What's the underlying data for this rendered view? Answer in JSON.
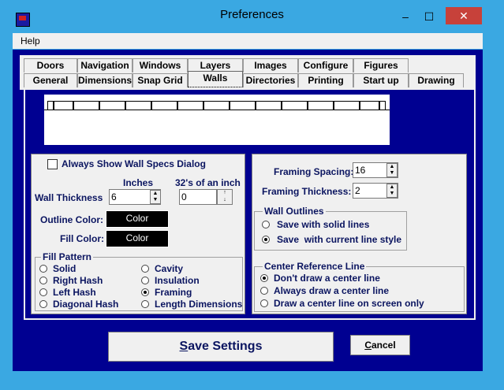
{
  "window": {
    "title": "Preferences",
    "minimize": "–",
    "maximize": "☐",
    "close": "✕"
  },
  "menu": {
    "help": "Help"
  },
  "tabs": {
    "row1": [
      "Doors",
      "Navigation",
      "Windows",
      "Layers",
      "Images",
      "Configure",
      "Figures"
    ],
    "row2": [
      "General",
      "Dimensions",
      "Snap Grid",
      "Walls",
      "Directories",
      "Printing",
      "Start up",
      "Drawing"
    ],
    "active": "Walls"
  },
  "left": {
    "always_show": "Always Show Wall Specs Dialog",
    "inches_label": "Inches",
    "fraction_label": "32's of an inch",
    "wall_thickness_label": "Wall Thickness",
    "inches_value": "6",
    "fraction_value": "0",
    "outline_color_label": "Outline Color:",
    "fill_color_label": "Fill Color:",
    "color_button": "Color",
    "fill_pattern": {
      "title": "Fill Pattern",
      "options": [
        "Solid",
        "Right Hash",
        "Left Hash",
        "Diagonal Hash",
        "Cavity",
        "Insulation",
        "Framing",
        "Length Dimensions"
      ],
      "selected": "Framing"
    }
  },
  "right": {
    "framing_spacing_label": "Framing Spacing:",
    "framing_spacing_value": "16",
    "framing_thickness_label": "Framing Thickness:",
    "framing_thickness_value": "2",
    "wall_outlines": {
      "title": "Wall Outlines",
      "options": [
        "Save with solid lines",
        "Save  with current line style"
      ],
      "selected": "Save  with current line style"
    },
    "center_line": {
      "title": "Center Reference Line",
      "options": [
        "Don't draw a center line",
        "Always draw a center line",
        "Draw a center line on screen only"
      ],
      "selected": "Don't draw a center line"
    }
  },
  "buttons": {
    "save_first": "S",
    "save_rest": "ave Settings",
    "cancel_first": "C",
    "cancel_rest": "ancel"
  },
  "colors": {
    "accent": "#000091",
    "frame": "#3aa8e2",
    "label": "#0b1560"
  }
}
